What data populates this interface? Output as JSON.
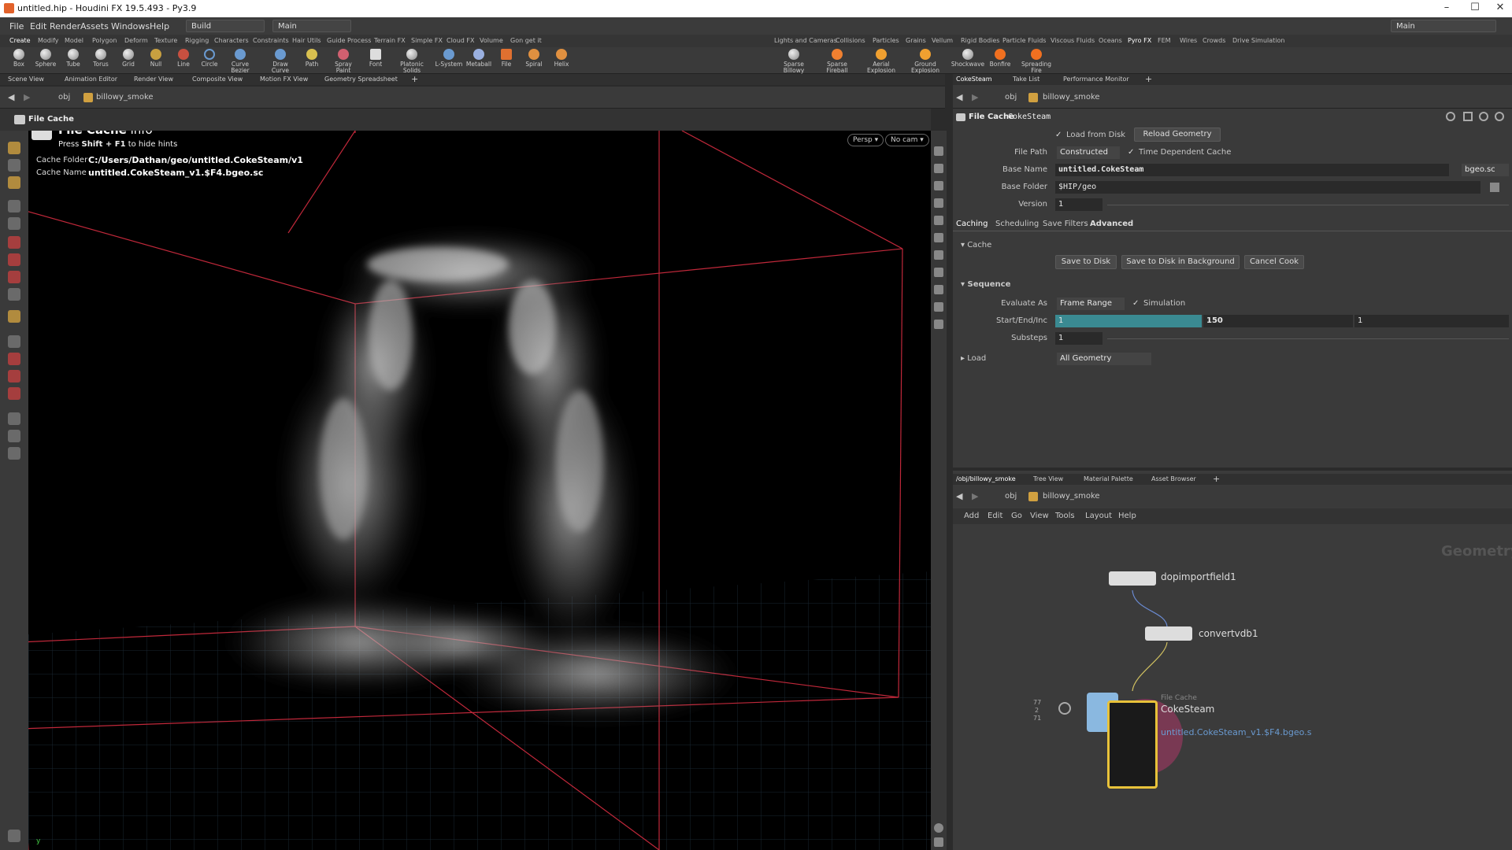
{
  "window": {
    "title": "untitled.hip - Houdini FX 19.5.493 - Py3.9",
    "controls": [
      "–",
      "☐",
      "✕"
    ]
  },
  "menubar": {
    "items": [
      "File",
      "Edit",
      "Render",
      "Assets",
      "Windows",
      "Help"
    ],
    "desktop_left": "Build",
    "desktop_mid": "Main",
    "desktop_right": "Main"
  },
  "shelf_tabs_left": [
    "Create",
    "Modify",
    "Model",
    "Polygon",
    "Deform",
    "Texture",
    "Rigging",
    "Characters",
    "Constraints",
    "Hair Utils",
    "Guide Process",
    "Terrain FX",
    "Simple FX",
    "Cloud FX",
    "Volume",
    "Gon get it"
  ],
  "shelf_tabs_right": [
    "Lights and Cameras",
    "Collisions",
    "Particles",
    "Grains",
    "Vellum",
    "Rigid Bodies",
    "Particle Fluids",
    "Viscous Fluids",
    "Oceans",
    "Pyro FX",
    "FEM",
    "Wires",
    "Crowds",
    "Drive Simulation"
  ],
  "tools_left": [
    "Box",
    "Sphere",
    "Tube",
    "Torus",
    "Grid",
    "Null",
    "Line",
    "Circle",
    "Curve Bezier",
    "Draw Curve",
    "Path",
    "Spray Paint",
    "Font",
    "Platonic Solids",
    "L-System",
    "Metaball",
    "File",
    "Spiral",
    "Helix"
  ],
  "tools_right": [
    "Sparse Billowy Smoke",
    "Sparse Fireball",
    "Aerial Explosion",
    "Ground Explosion",
    "Shockwave",
    "Bonfire",
    "Spreading Fire"
  ],
  "left_pane_tabs": [
    "Scene View",
    "Animation Editor",
    "Render View",
    "Composite View",
    "Motion FX View",
    "Geometry Spreadsheet"
  ],
  "left_path": {
    "context": "obj",
    "node": "billowy_smoke"
  },
  "viewport": {
    "header": "File Cache",
    "info_title": "File Cache",
    "info_suffix": "info",
    "hint_prefix": "Press",
    "hint_keys": "Shift + F1",
    "hint_suffix": "to hide hints",
    "cache_folder_label": "Cache Folder",
    "cache_folder_value": "C:/Users/Dathan/geo/untitled.CokeSteam/v1",
    "cache_name_label": "Cache Name",
    "cache_name_value": "untitled.CokeSteam_v1.$F4.bgeo.sc",
    "persp_btn": "Persp ▾",
    "cam_btn": "No cam ▾",
    "axis_label": "y"
  },
  "right_pane_tabs": [
    "CokeSteam",
    "Take List",
    "Performance Monitor"
  ],
  "right_path": {
    "context": "obj",
    "node": "billowy_smoke"
  },
  "params": {
    "node_type": "File Cache",
    "node_name": "CokeSteam",
    "load_from_disk": "Load from Disk",
    "reload_geometry": "Reload Geometry",
    "file_path_label": "File Path",
    "file_path_value": "Constructed",
    "time_dependent": "Time Dependent Cache",
    "base_name_label": "Base Name",
    "base_name_value": "untitled.CokeSteam",
    "ext_value": "bgeo.sc",
    "base_folder_label": "Base Folder",
    "base_folder_value": "$HIP/geo",
    "version_label": "Version",
    "version_value": "1",
    "tabs": [
      "Caching",
      "Scheduling",
      "Save Filters",
      "Advanced"
    ],
    "cache_section": "Cache",
    "save_to_disk": "Save to Disk",
    "save_bg": "Save to Disk in Background",
    "cancel_cook": "Cancel Cook",
    "sequence_section": "Sequence",
    "evaluate_label": "Evaluate As",
    "evaluate_value": "Frame Range",
    "simulation": "Simulation",
    "start_label": "Start/End/Inc",
    "start_value": "1",
    "end_value": "150",
    "inc_value": "1",
    "substeps_label": "Substeps",
    "substeps_value": "1",
    "load_section": "Load",
    "load_value": "All Geometry"
  },
  "network_tabs": [
    "/obj/billowy_smoke",
    "Tree View",
    "Material Palette",
    "Asset Browser"
  ],
  "network_path": {
    "context": "obj",
    "node": "billowy_smoke"
  },
  "network_menu": [
    "Add",
    "Edit",
    "Go",
    "View",
    "Tools",
    "Layout",
    "Help"
  ],
  "network": {
    "watermark": "Geometry",
    "node1": "dopimportfield1",
    "node2": "convertvdb1",
    "node3_type": "File Cache",
    "node3_name": "CokeSteam",
    "node3_file": "untitled.CokeSteam_v1.$F4.bgeo.s",
    "counts": [
      "77",
      "2",
      "71"
    ]
  },
  "colors": {
    "accent_teal": "#3a8a92",
    "viewport_bg": "#000000",
    "bbox_red": "#c0283a",
    "node_yellow": "#e8c23a"
  }
}
